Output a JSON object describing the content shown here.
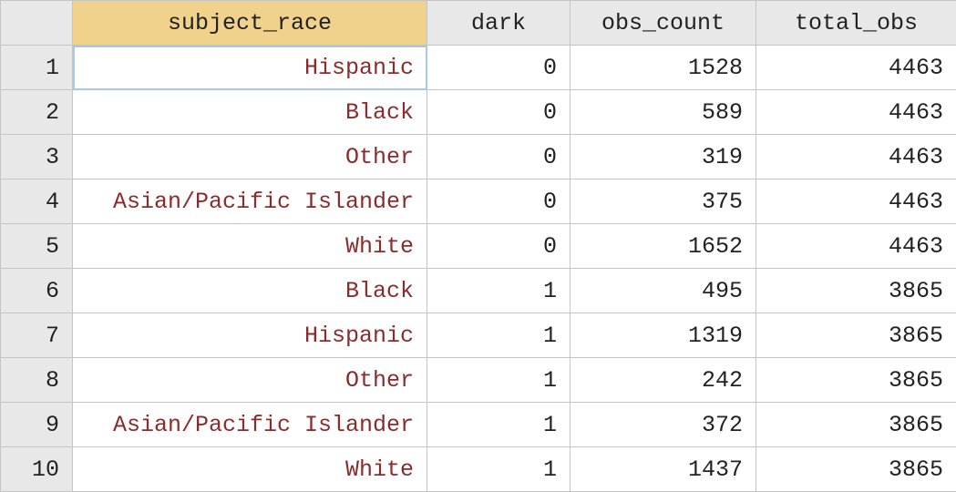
{
  "columns": {
    "subject_race": "subject_race",
    "dark": "dark",
    "obs_count": "obs_count",
    "total_obs": "total_obs"
  },
  "rows": [
    {
      "n": "1",
      "subject_race": "Hispanic",
      "dark": "0",
      "obs_count": "1528",
      "total_obs": "4463"
    },
    {
      "n": "2",
      "subject_race": "Black",
      "dark": "0",
      "obs_count": "589",
      "total_obs": "4463"
    },
    {
      "n": "3",
      "subject_race": "Other",
      "dark": "0",
      "obs_count": "319",
      "total_obs": "4463"
    },
    {
      "n": "4",
      "subject_race": "Asian/Pacific Islander",
      "dark": "0",
      "obs_count": "375",
      "total_obs": "4463"
    },
    {
      "n": "5",
      "subject_race": "White",
      "dark": "0",
      "obs_count": "1652",
      "total_obs": "4463"
    },
    {
      "n": "6",
      "subject_race": "Black",
      "dark": "1",
      "obs_count": "495",
      "total_obs": "3865"
    },
    {
      "n": "7",
      "subject_race": "Hispanic",
      "dark": "1",
      "obs_count": "1319",
      "total_obs": "3865"
    },
    {
      "n": "8",
      "subject_race": "Other",
      "dark": "1",
      "obs_count": "242",
      "total_obs": "3865"
    },
    {
      "n": "9",
      "subject_race": "Asian/Pacific Islander",
      "dark": "1",
      "obs_count": "372",
      "total_obs": "3865"
    },
    {
      "n": "10",
      "subject_race": "White",
      "dark": "1",
      "obs_count": "1437",
      "total_obs": "3865"
    }
  ]
}
